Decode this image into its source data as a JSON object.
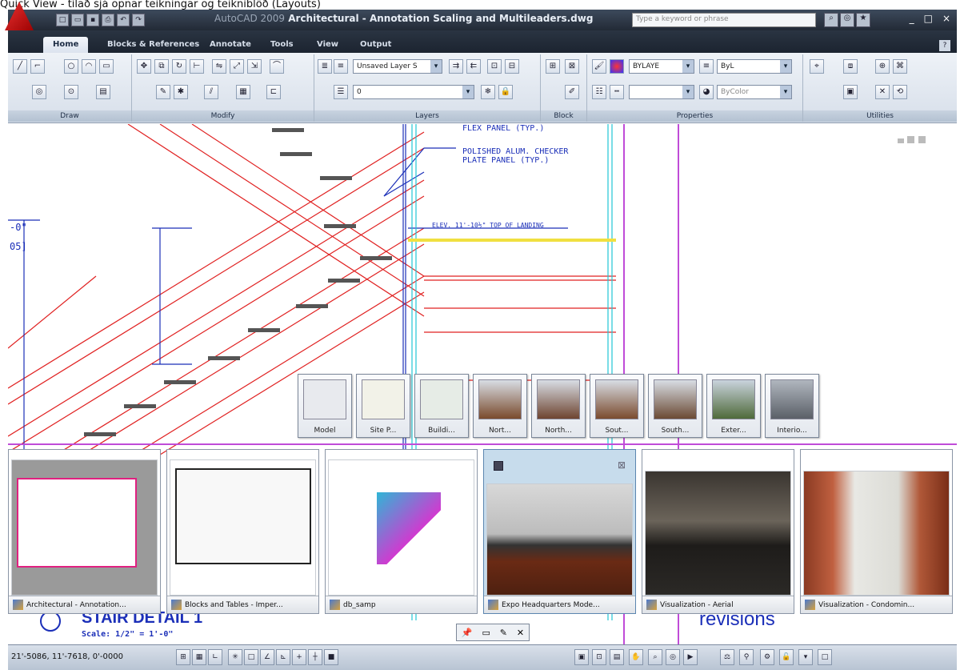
{
  "caption": "Quick View - tilað sjá opnar teikningar og teikniblöð (Layouts)",
  "window": {
    "title_dim": "AutoCAD 2009",
    "title": "Architectural - Annotation Scaling and Multileaders.dwg",
    "search_placeholder": "Type a keyword or phrase",
    "controls": [
      "_",
      "□",
      "×"
    ]
  },
  "tabs": [
    {
      "label": "Home",
      "active": true
    },
    {
      "label": "Blocks & References",
      "active": false
    },
    {
      "label": "Annotate",
      "active": false
    },
    {
      "label": "Tools",
      "active": false
    },
    {
      "label": "View",
      "active": false
    },
    {
      "label": "Output",
      "active": false
    }
  ],
  "ribbon": {
    "panels": [
      "Draw",
      "Modify",
      "Layers",
      "Block",
      "Properties",
      "Utilities"
    ],
    "layer_combo": "Unsaved Layer S",
    "layer_name": "0",
    "color_combo": "BYLAYE",
    "linetype_combo": "ByL",
    "plotstyle_combo": "ByColor"
  },
  "drawing": {
    "annotations": [
      "FLEX PANEL (TYP.)",
      "POLISHED ALUM. CHECKER\nPLATE PANEL (TYP.)",
      "ELEV. 11'-10½\" TOP OF LANDING",
      "-0\"",
      "05]",
      "STAIR DETAIL 1",
      "Scale: 1/2\" = 1'-0\"",
      "revisions"
    ]
  },
  "quick_view_layouts": [
    "Model",
    "Site P...",
    "Buildi...",
    "Nort...",
    "North...",
    "Sout...",
    "South...",
    "Exter...",
    "Interio..."
  ],
  "quick_view_drawings": [
    {
      "label": "Architectural - Annotation...",
      "active": false
    },
    {
      "label": "Blocks and Tables - Imper...",
      "active": false
    },
    {
      "label": "db_samp",
      "active": false
    },
    {
      "label": "Expo Headquarters Mode...",
      "active": true
    },
    {
      "label": "Visualization - Aerial",
      "active": false
    },
    {
      "label": "Visualization - Condomin...",
      "active": false
    }
  ],
  "quick_view_controls": [
    "pin-icon",
    "open-icon",
    "close-icon"
  ],
  "statusbar": {
    "coords": "21'-5086, 11'-7618, 0'-0000"
  },
  "colors": {
    "title_bar": "#2a3442",
    "ribbon": "#dfe6ef",
    "drawing_red": "#e02020",
    "drawing_magenta": "#c04cd8",
    "drawing_cyan": "#21c6d6",
    "annotation_blue": "#1b2fb8"
  }
}
